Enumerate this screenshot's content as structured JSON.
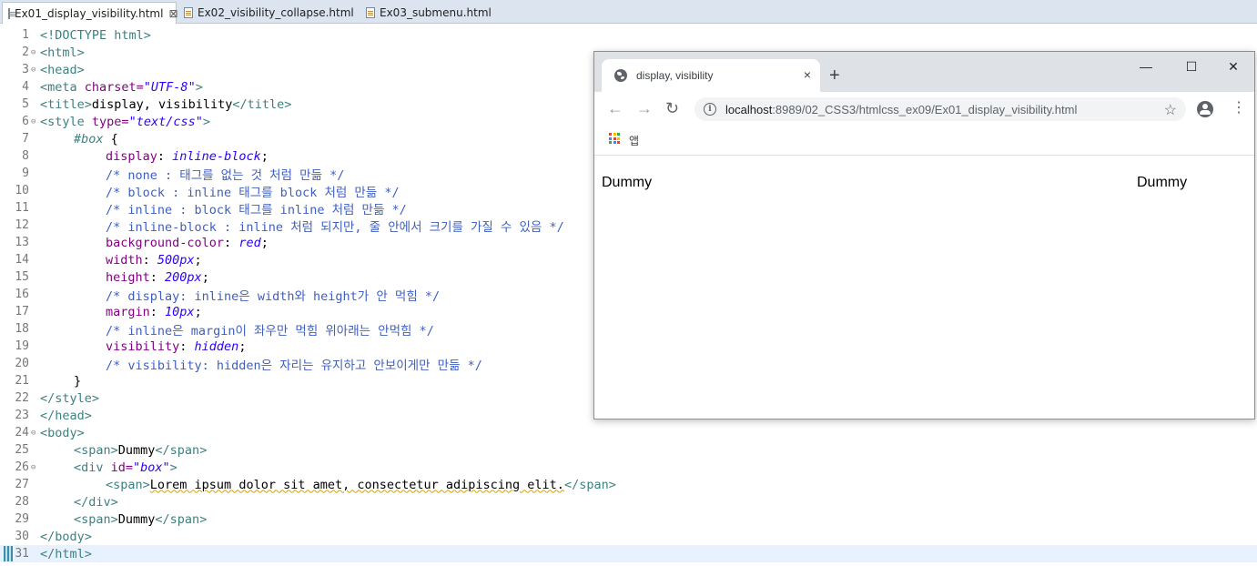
{
  "editor_tabs": [
    {
      "label": "Ex01_display_visibility.html",
      "active": true
    },
    {
      "label": "Ex02_visibility_collapse.html",
      "active": false
    },
    {
      "label": "Ex03_submenu.html",
      "active": false
    }
  ],
  "code_lines": [
    {
      "n": "1"
    },
    {
      "n": "2"
    },
    {
      "n": "3"
    },
    {
      "n": "4"
    },
    {
      "n": "5"
    },
    {
      "n": "6"
    },
    {
      "n": "7"
    },
    {
      "n": "8"
    },
    {
      "n": "9"
    },
    {
      "n": "10"
    },
    {
      "n": "11"
    },
    {
      "n": "12"
    },
    {
      "n": "13"
    },
    {
      "n": "14"
    },
    {
      "n": "15"
    },
    {
      "n": "16"
    },
    {
      "n": "17"
    },
    {
      "n": "18"
    },
    {
      "n": "19"
    },
    {
      "n": "20"
    },
    {
      "n": "21"
    },
    {
      "n": "22"
    },
    {
      "n": "23"
    },
    {
      "n": "24"
    },
    {
      "n": "25"
    },
    {
      "n": "26"
    },
    {
      "n": "27"
    },
    {
      "n": "28"
    },
    {
      "n": "29"
    },
    {
      "n": "30"
    },
    {
      "n": "31"
    }
  ],
  "code": {
    "l1": "<!DOCTYPE html>",
    "l2": "<html>",
    "l3": "<head>",
    "l4_tag": "<meta",
    "l4_attr": " charset=",
    "l4_val": "\"UTF-8\"",
    "l4_end": ">",
    "l5_open": "<title>",
    "l5_text": "display, visibility",
    "l5_close": "</title>",
    "l6_tag": "<style",
    "l6_attr": " type=",
    "l6_val": "\"text/css\"",
    "l6_end": ">",
    "l7_sel": "#box",
    "l7_brace": " {",
    "l8_prop": "display",
    "l8_val": "inline-block",
    "l9": "/* none : 태그를 없는 것 처럼 만듦 */",
    "l10": "/* block : inline 태그를 block 처럼 만듦 */",
    "l11": "/* inline : block 태그를 inline 처럼 만듦 */",
    "l12": "/* inline-block : inline 처럼 되지만, 줄 안에서 크기를 가질 수 있음 */",
    "l13_prop": "background-color",
    "l13_val": "red",
    "l14_prop": "width",
    "l14_val": "500px",
    "l15_prop": "height",
    "l15_val": "200px",
    "l16": "/* display: inline은 width와 height가 안 먹힘 */",
    "l17_prop": "margin",
    "l17_val": "10px",
    "l18": "/* inline은 margin이 좌우만 먹힘 위아래는 안먹힘 */",
    "l19_prop": "visibility",
    "l19_val": "hidden",
    "l20": "/* visibility: hidden은 자리는 유지하고 안보이게만 만듦 */",
    "l21": "}",
    "l22": "</style>",
    "l23": "</head>",
    "l24": "<body>",
    "l25_open": "<span>",
    "l25_text": "Dummy",
    "l25_close": "</span>",
    "l26_tag": "<div",
    "l26_attr": " id=",
    "l26_val": "\"box\"",
    "l26_end": ">",
    "l27_open": "<span>",
    "l27_text": "Lorem ipsum dolor sit amet, consectetur adipiscing elit.",
    "l27_close": "</span>",
    "l28": "</div>",
    "l29_open": "<span>",
    "l29_text": "Dummy",
    "l29_close": "</span>",
    "l30": "</body>",
    "l31": "</html>"
  },
  "browser": {
    "tab_title": "display, visibility",
    "tab_close": "×",
    "new_tab": "+",
    "minimize": "—",
    "maximize": "☐",
    "close": "✕",
    "back": "←",
    "forward": "→",
    "reload": "↻",
    "info": "i",
    "url_host": "localhost",
    "url_path": ":8989/02_CSS3/htmlcss_ex09/Ex01_display_visibility.html",
    "bookmark_star": "☆",
    "menu": "⋮",
    "apps_label": "앱",
    "apps_colors": [
      "#ea4335",
      "#fbbc05",
      "#34a853",
      "#4285f4",
      "#ea4335",
      "#fbbc05",
      "#34a853",
      "#4285f4",
      "#ea4335"
    ],
    "content": {
      "dummy_left": "Dummy",
      "dummy_right": "Dummy"
    }
  }
}
